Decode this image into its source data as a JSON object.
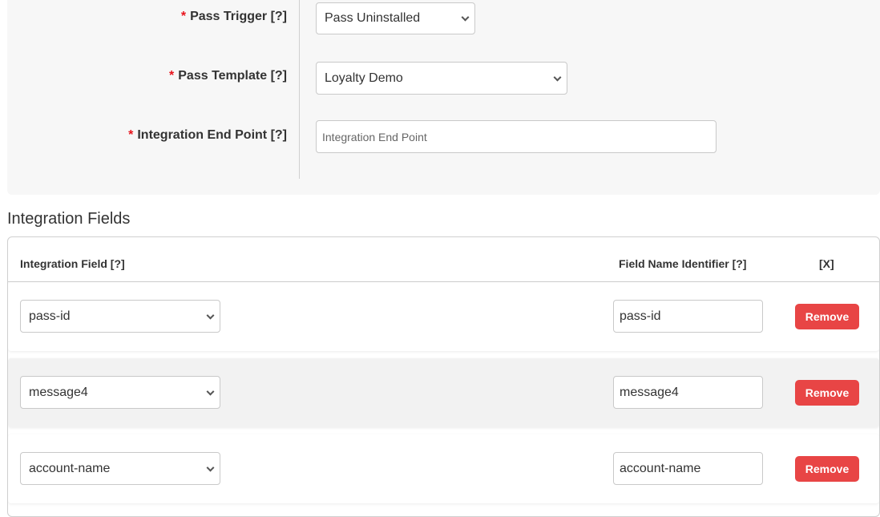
{
  "form": {
    "required_marker": "*",
    "pass_trigger": {
      "label": "Pass Trigger [?]",
      "value": "Pass Uninstalled"
    },
    "pass_template": {
      "label": "Pass Template [?]",
      "value": "Loyalty Demo"
    },
    "integration_end_point": {
      "label": "Integration End Point [?]",
      "value": "",
      "placeholder": "Integration End Point"
    }
  },
  "integration_fields": {
    "title": "Integration Fields",
    "columns": [
      "Integration Field [?]",
      "Field Name Identifier [?]",
      "[X]"
    ],
    "rows": [
      {
        "field": "pass-id",
        "identifier": "pass-id",
        "action": "Remove"
      },
      {
        "field": "message4",
        "identifier": "message4",
        "action": "Remove"
      },
      {
        "field": "account-name",
        "identifier": "account-name",
        "action": "Remove"
      }
    ]
  },
  "colors": {
    "required": "#e8141c",
    "remove_button": "#e84545",
    "panel_bg": "#f7f7f7",
    "alt_row_bg": "#f2f2f2"
  }
}
